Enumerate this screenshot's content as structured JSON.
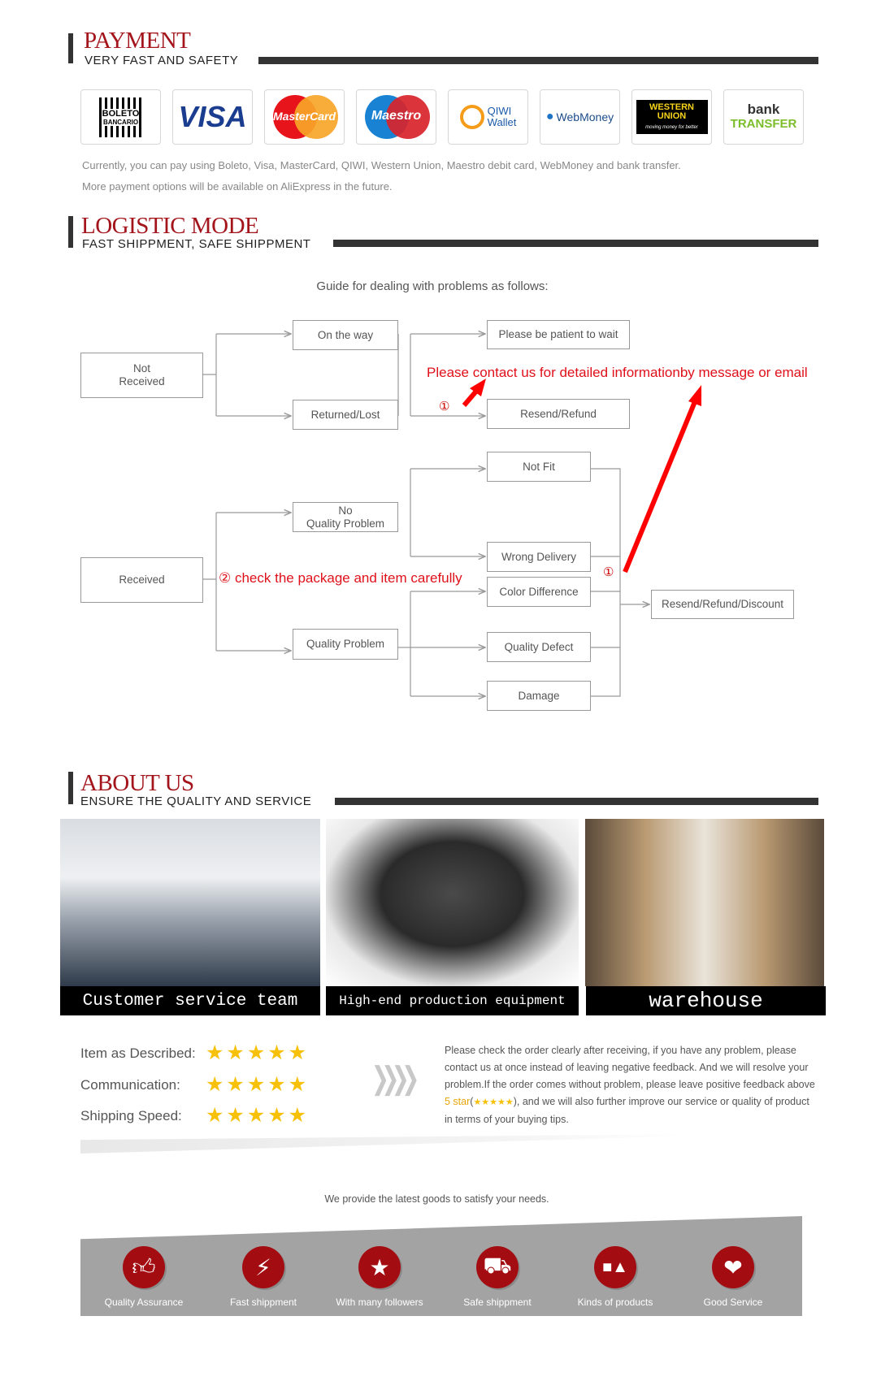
{
  "payment": {
    "title": "PAYMENT",
    "subtitle": "VERY FAST AND SAFETY",
    "logos": [
      {
        "name": "boleto",
        "line1": "BOLETO",
        "line2": "BANCARIO"
      },
      {
        "name": "visa",
        "text": "VISA"
      },
      {
        "name": "mastercard",
        "text": "MasterCard"
      },
      {
        "name": "maestro",
        "text": "Maestro"
      },
      {
        "name": "qiwi",
        "line1": "QIWI",
        "line2": "Wallet"
      },
      {
        "name": "webmoney",
        "text": "WebMoney"
      },
      {
        "name": "western-union",
        "line1": "WESTERN",
        "line2": "UNION",
        "tagline": "moving money for better"
      },
      {
        "name": "bank-transfer",
        "line1": "bank",
        "line2": "TRANSFER"
      }
    ],
    "text1": "Currently, you can pay using Boleto, Visa, MasterCard, QIWI, Western Union, Maestro debit card, WebMoney and bank transfer.",
    "text2": "More payment options will be available on AliExpress in the future."
  },
  "logistic": {
    "title": "LOGISTIC MODE",
    "subtitle": "FAST SHIPPMENT, SAFE SHIPPMENT",
    "guide": "Guide for dealing with problems as follows:",
    "boxes": {
      "not_received_1": "Not",
      "not_received_2": "Received",
      "on_the_way": "On the way",
      "returned_lost": "Returned/Lost",
      "patient": "Please be patient to wait",
      "resend_refund": "Resend/Refund",
      "not_fit": "Not Fit",
      "no_quality_1": "No",
      "no_quality_2": "Quality Problem",
      "received": "Received",
      "wrong_delivery": "Wrong Delivery",
      "color_difference": "Color Difference",
      "quality_problem": "Quality Problem",
      "quality_defect": "Quality Defect",
      "damage": "Damage",
      "resend_refund_discount": "Resend/Refund/Discount"
    },
    "note_contact": "Please contact us for detailed informationby message or email",
    "note_check": "② check the package and item carefully",
    "marker1": "①",
    "marker2": "①",
    "accent_color": "#e0101a"
  },
  "about": {
    "title": "ABOUT US",
    "subtitle": "ENSURE THE QUALITY AND SERVICE",
    "photos": [
      {
        "caption": "Customer service team"
      },
      {
        "caption": "High-end production equipment"
      },
      {
        "caption": "warehouse"
      }
    ],
    "ratings": [
      {
        "label": "Item as Described:",
        "stars": 5
      },
      {
        "label": "Communication:",
        "stars": 5
      },
      {
        "label": "Shipping Speed:",
        "stars": 5
      }
    ],
    "feedback_a": "Please check the order clearly after receiving, if you have any problem, please contact us at once instead of leaving negative feedback. And we will resolve your problem.If the order comes without problem, please leave positive feedback above ",
    "feedback_star": "5 star",
    "feedback_b": "), and we will also further improve our service or quality of product in terms of your buying tips.",
    "tagline": "We provide the latest goods to satisfy your needs.",
    "features": [
      {
        "label": "Quality Assurance",
        "icon": "thumbs-up-icon"
      },
      {
        "label": "Fast shippment",
        "icon": "lightning-icon"
      },
      {
        "label": "With many followers",
        "icon": "star-icon"
      },
      {
        "label": "Safe shippment",
        "icon": "truck-icon"
      },
      {
        "label": "Kinds of products",
        "icon": "shapes-icon"
      },
      {
        "label": "Good Service",
        "icon": "heart-icon"
      }
    ],
    "star_color": "#f7c10a",
    "brand_red": "#a30d12"
  }
}
